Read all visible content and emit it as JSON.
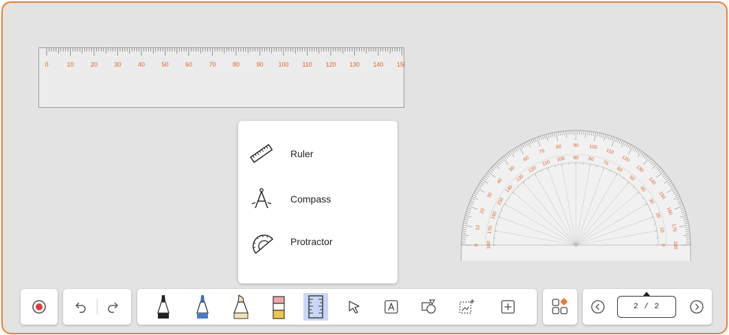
{
  "ruler": {
    "ticks_labels": [
      "0",
      "10",
      "20",
      "30",
      "40",
      "50",
      "60",
      "70",
      "80",
      "90",
      "100",
      "110",
      "120",
      "130",
      "140",
      "150"
    ]
  },
  "tool_menu": {
    "items": [
      {
        "label": "Ruler",
        "icon": "ruler-icon"
      },
      {
        "label": "Compass",
        "icon": "compass-icon"
      },
      {
        "label": "Protractor",
        "icon": "protractor-icon"
      }
    ]
  },
  "protractor": {
    "outer_labels": [
      "0",
      "10",
      "20",
      "30",
      "40",
      "50",
      "60",
      "70",
      "80",
      "90",
      "100",
      "110",
      "120",
      "130",
      "140",
      "150",
      "160",
      "170",
      "180"
    ],
    "inner_labels": [
      "180",
      "170",
      "160",
      "150",
      "140",
      "130",
      "120",
      "110",
      "100",
      "90",
      "80",
      "70",
      "60",
      "50",
      "40",
      "30",
      "20",
      "10",
      "0"
    ]
  },
  "toolbar": {
    "record_icon": "record-icon",
    "undo_icon": "undo-icon",
    "redo_icon": "redo-icon",
    "tools": [
      "black-marker-icon",
      "blue-marker-icon",
      "highlighter-icon",
      "eraser-icon",
      "ruler-tool-icon",
      "select-arrow-icon",
      "text-box-icon",
      "shapes-icon",
      "image-insert-icon",
      "add-icon"
    ],
    "apps_icon": "apps-icon",
    "page_indicator": "2 / 2",
    "active_tool": "ruler-tool-icon",
    "accent_color": "#f07b2e",
    "record_color": "#e53935"
  }
}
